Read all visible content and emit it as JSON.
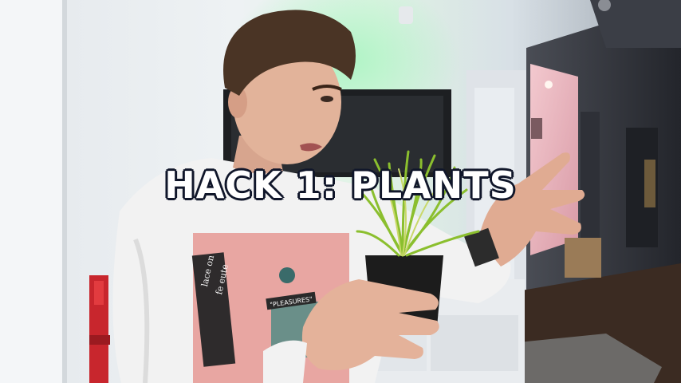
{
  "caption": "HACK 1: PLANTS",
  "shirt_print": {
    "line1": "lace  on",
    "line2": "fe  eute",
    "badge": "\"PLEASURES\""
  },
  "colors": {
    "wall_left": "#eceff1",
    "wall_glow": "#b9f2c8",
    "shirt": "#f2f2f2",
    "print_bg": "#e8a6a2",
    "plant_green": "#8bbf2e",
    "pot": "#1c1c1c",
    "caption_text": "#ffffff",
    "caption_outline": "#10162a"
  }
}
